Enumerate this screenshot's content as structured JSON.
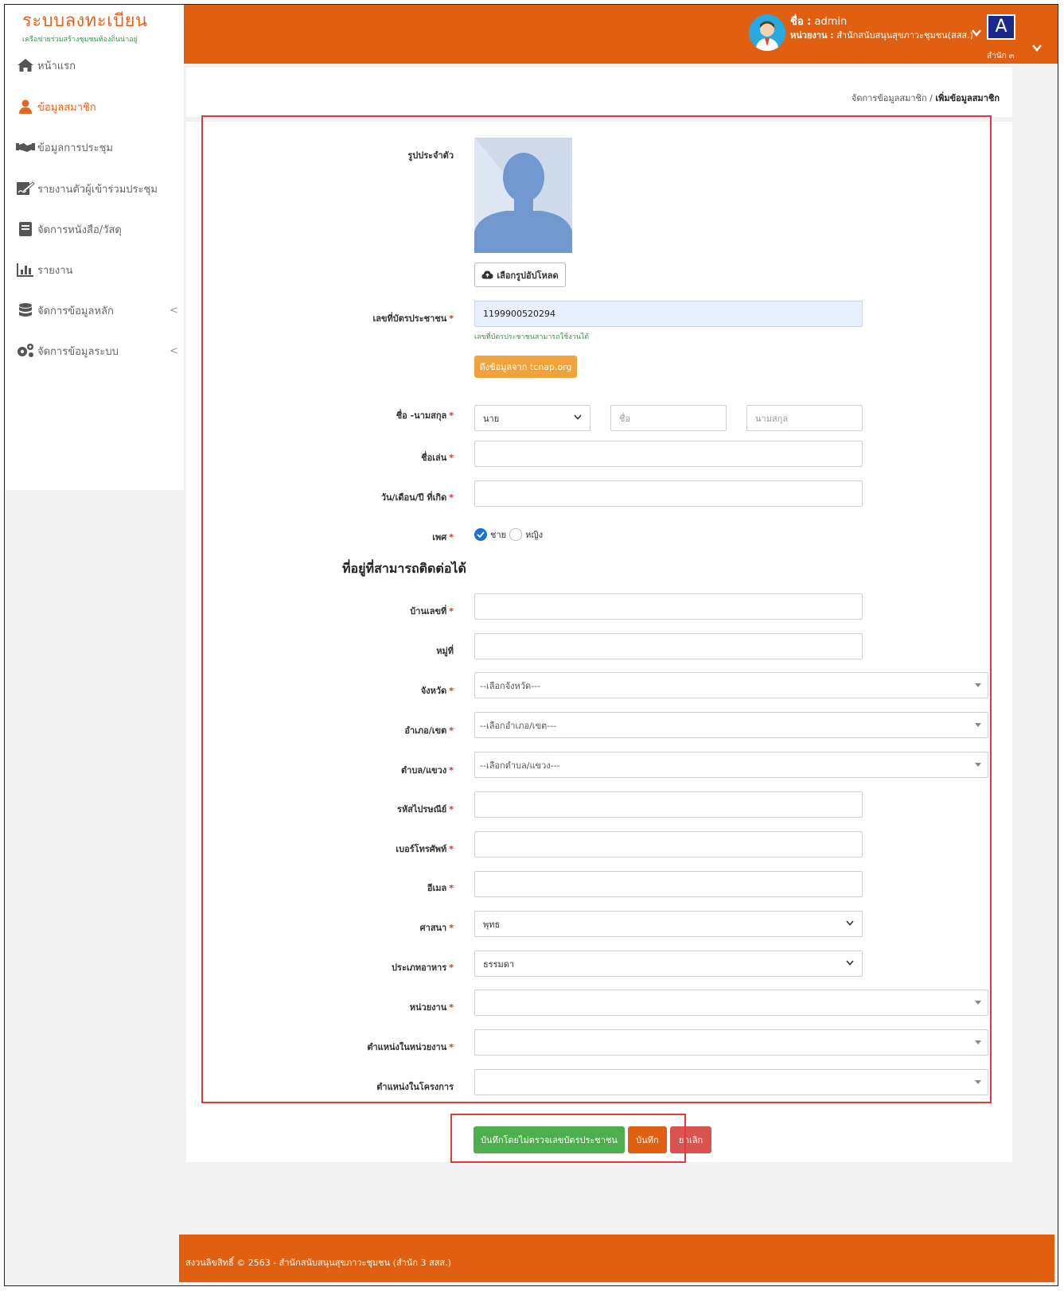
{
  "brand": {
    "title": "ระบบลงทะเบียน",
    "subtitle": "เครือข่ายร่วมสร้างชุมชนท้องถิ่นน่าอยู่"
  },
  "sidebar": {
    "items": [
      {
        "label": "หน้าแรก",
        "icon": "home-icon"
      },
      {
        "label": "ข้อมูลสมาชิก",
        "icon": "user-icon",
        "active": true
      },
      {
        "label": "ข้อมูลการประชุม",
        "icon": "handshake-icon"
      },
      {
        "label": "รายงานตัวผู้เข้าร่วมประชุม",
        "icon": "signature-icon"
      },
      {
        "label": "จัดการหนังสือ/วัสดุ",
        "icon": "book-icon"
      },
      {
        "label": "รายงาน",
        "icon": "bar-chart-icon"
      },
      {
        "label": "จัดการข้อมูลหลัก",
        "icon": "database-icon",
        "chevron": "<"
      },
      {
        "label": "จัดการข้อมูลระบบ",
        "icon": "gears-icon",
        "chevron": "<"
      }
    ]
  },
  "topbar": {
    "name_label": "ชื่อ :",
    "name_value": "admin",
    "unit_label": "หน่วยงาน :",
    "unit_value": "สำนักสนับสนุนสุขภาวะชุมชน(สสส.)",
    "tile_letter": "A",
    "tile_caption": "สำนัก ๓"
  },
  "breadcrumb": {
    "parent": "จัดการข้อมูลสมาชิก",
    "separator": " / ",
    "current": "เพิ่มข้อมูลสมาชิก"
  },
  "form": {
    "photo_label": "รูปประจำตัว",
    "upload_button": "เลือกรูปอัปโหลด",
    "id_label": "เลขที่บัตรประชาชน",
    "id_value": "1199900520294",
    "id_hint": "เลขที่บัตรประชาชนสามารถใช้งานได้",
    "fetch_button": "ดึงข้อมูลจาก tcnap.org",
    "name_label": "ชื่อ -นามสกุล",
    "prefix_value": "นาย",
    "first_placeholder": "ชื่อ",
    "last_placeholder": "นามสกุล",
    "nickname_label": "ชื่อเล่น",
    "dob_label": "วัน/เดือน/ปี ที่เกิด",
    "gender_label": "เพศ",
    "gender_male": "ชาย",
    "gender_female": "หญิง",
    "address_title": "ที่อยู่ที่สามารถติดต่อได้",
    "house_label": "บ้านเลขที่",
    "moo_label": "หมู่ที่",
    "province_label": "จังหวัด",
    "province_placeholder": "--เลือกจังหวัด---",
    "district_label": "อำเภอ/เขต",
    "district_placeholder": "--เลือกอำเภอ/เขต---",
    "subdistrict_label": "ตำบล/แขวง",
    "subdistrict_placeholder": "--เลือกตำบล/แขวง---",
    "postcode_label": "รหัสไปรษณีย์",
    "phone_label": "เบอร์โทรศัพท์",
    "email_label": "อีเมล",
    "religion_label": "ศาสนา",
    "religion_value": "พุทธ",
    "food_label": "ประเภทอาหาร",
    "food_value": "ธรรมดา",
    "unit_label": "หน่วยงาน",
    "unit_position_label": "ตำแหน่งในหน่วยงาน",
    "project_position_label": "ตำแหน่งในโครงการ",
    "required_mark": "*"
  },
  "actions": {
    "save_no_check": "บันทึกโดยไม่ตรวจเลขบัตรประชาชน",
    "save": "บันทึก",
    "cancel": "ยกเลิก"
  },
  "footer": {
    "text": "สงวนลิขสิทธิ์ © 2563 - สำนักสนับสนุนสุขภาวะชุมชน (สำนัก 3 สสส.)"
  },
  "colors": {
    "accent": "#e05f10",
    "brand_text": "#e8641e",
    "success": "#4cae4c",
    "warning": "#f0a33c",
    "danger": "#d9534f"
  }
}
